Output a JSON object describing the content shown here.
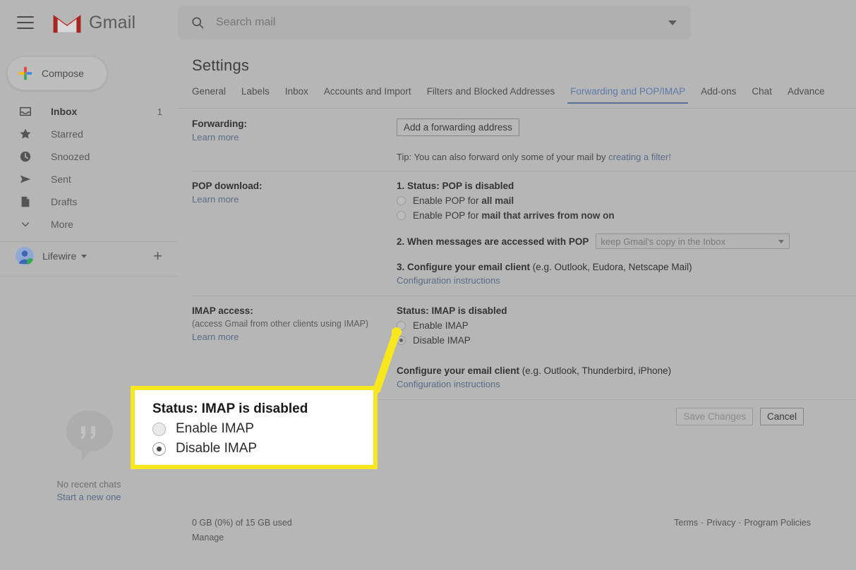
{
  "header": {
    "menu_icon": "hamburger-icon",
    "logo_icon": "gmail-m-icon",
    "brand": "Gmail",
    "search": {
      "icon": "search-icon",
      "placeholder": "Search mail",
      "value": "",
      "options_icon": "chevron-down-icon"
    }
  },
  "sidebar": {
    "compose": {
      "icon": "plus-icon",
      "label": "Compose"
    },
    "items": [
      {
        "label": "Inbox",
        "icon": "inbox-icon",
        "count": "1",
        "active": true
      },
      {
        "label": "Starred",
        "icon": "star-icon",
        "count": ""
      },
      {
        "label": "Snoozed",
        "icon": "clock-icon",
        "count": ""
      },
      {
        "label": "Sent",
        "icon": "send-icon",
        "count": ""
      },
      {
        "label": "Drafts",
        "icon": "document-icon",
        "count": ""
      },
      {
        "label": "More",
        "icon": "chevron-down-icon",
        "count": ""
      }
    ],
    "account": {
      "name": "Lifewire",
      "avatar_icon": "avatar-icon",
      "caret_icon": "chevron-down-icon",
      "add_icon": "plus-icon"
    },
    "chat": {
      "icon": "hangouts-bubble-icon",
      "no_chats": "No recent chats",
      "start_new": "Start a new one"
    }
  },
  "main": {
    "page_title": "Settings",
    "tabs": [
      {
        "label": "General",
        "active": false
      },
      {
        "label": "Labels",
        "active": false
      },
      {
        "label": "Inbox",
        "active": false
      },
      {
        "label": "Accounts and Import",
        "active": false
      },
      {
        "label": "Filters and Blocked Addresses",
        "active": false
      },
      {
        "label": "Forwarding and POP/IMAP",
        "active": true
      },
      {
        "label": "Add-ons",
        "active": false
      },
      {
        "label": "Chat",
        "active": false
      },
      {
        "label": "Advance",
        "active": false
      }
    ],
    "forwarding": {
      "title": "Forwarding:",
      "learn_more": "Learn more",
      "add_button": "Add a forwarding address",
      "tip_prefix": "Tip: You can also forward only some of your mail by ",
      "tip_link": "creating a filter!"
    },
    "pop": {
      "title": "POP download:",
      "learn_more": "Learn more",
      "step1": "1. Status: POP is disabled",
      "radio_all_prefix": "Enable POP for ",
      "radio_all_bold": "all mail",
      "radio_all_checked": false,
      "radio_now_prefix": "Enable POP for ",
      "radio_now_bold": "mail that arrives from now on",
      "radio_now_checked": false,
      "step2_label": "2. When messages are accessed with POP",
      "step2_select_value": "keep Gmail's copy in the Inbox",
      "step3_bold": "3. Configure your email client",
      "step3_rest": " (e.g. Outlook, Eudora, Netscape Mail)",
      "config_link": "Configuration instructions"
    },
    "imap": {
      "title": "IMAP access:",
      "subtitle": "(access Gmail from other clients using IMAP)",
      "learn_more": "Learn more",
      "status": "Status: IMAP is disabled",
      "radio_enable": "Enable IMAP",
      "radio_enable_checked": false,
      "radio_disable": "Disable IMAP",
      "radio_disable_checked": true,
      "config_bold": "Configure your email client",
      "config_rest": " (e.g. Outlook, Thunderbird, iPhone)",
      "config_link": "Configuration instructions"
    },
    "actions": {
      "save_label": "Save Changes",
      "save_disabled": true,
      "cancel_label": "Cancel"
    },
    "footer": {
      "storage": "0 GB (0%) of 15 GB used",
      "manage": "Manage",
      "terms": "Terms",
      "privacy": "Privacy",
      "policies": "Program Policies",
      "separator": "·"
    }
  },
  "callout": {
    "status": "Status: IMAP is disabled",
    "enable_label": "Enable IMAP",
    "enable_checked": false,
    "disable_label": "Disable IMAP",
    "disable_checked": true,
    "border_color": "#f9e71e",
    "background": "#ffffff"
  },
  "colors": {
    "page_dim": "#b6b6b6",
    "accent_blue": "#5b6b86",
    "highlight_yellow": "#f9e71e",
    "gmail_red": "#c5221f"
  }
}
